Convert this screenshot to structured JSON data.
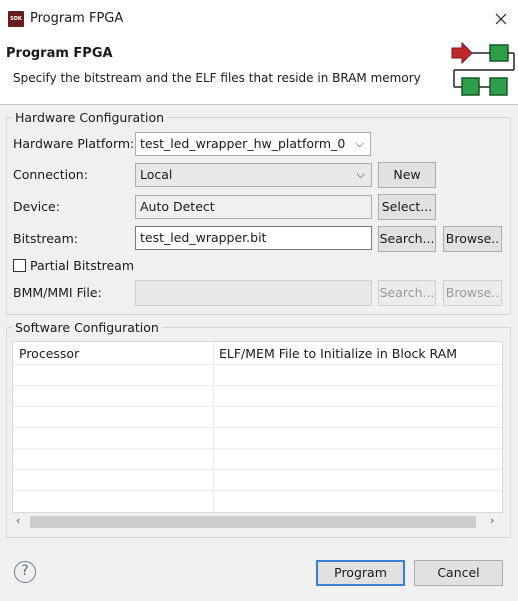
{
  "window": {
    "app_icon_text": "SDK",
    "title": "Program FPGA"
  },
  "header": {
    "title": "Program FPGA",
    "description": "Specify the bitstream and the ELF files that reside in BRAM memory"
  },
  "hardware": {
    "legend": "Hardware Configuration",
    "platform_label": "Hardware Platform:",
    "platform_value": "test_led_wrapper_hw_platform_0",
    "connection_label": "Connection:",
    "connection_value": "Local",
    "new_button": "New",
    "device_label": "Device:",
    "device_value": "Auto Detect",
    "select_button": "Select...",
    "bitstream_label": "Bitstream:",
    "bitstream_value": "test_led_wrapper.bit",
    "bitstream_search_button": "Search...",
    "bitstream_browse_button": "Browse..",
    "partial_bitstream_label": "Partial Bitstream",
    "partial_bitstream_checked": false,
    "bmm_label": "BMM/MMI File:",
    "bmm_value": "",
    "bmm_search_button": "Search...",
    "bmm_browse_button": "Browse.."
  },
  "software": {
    "legend": "Software Configuration",
    "columns": [
      "Processor",
      "ELF/MEM File to Initialize in Block RAM"
    ],
    "rows": []
  },
  "footer": {
    "help_icon": "?",
    "program_button": "Program",
    "cancel_button": "Cancel"
  },
  "colors": {
    "accent_red": "#c0282d",
    "accent_green": "#2e9e4a",
    "default_button_border": "#3c7fd1"
  }
}
